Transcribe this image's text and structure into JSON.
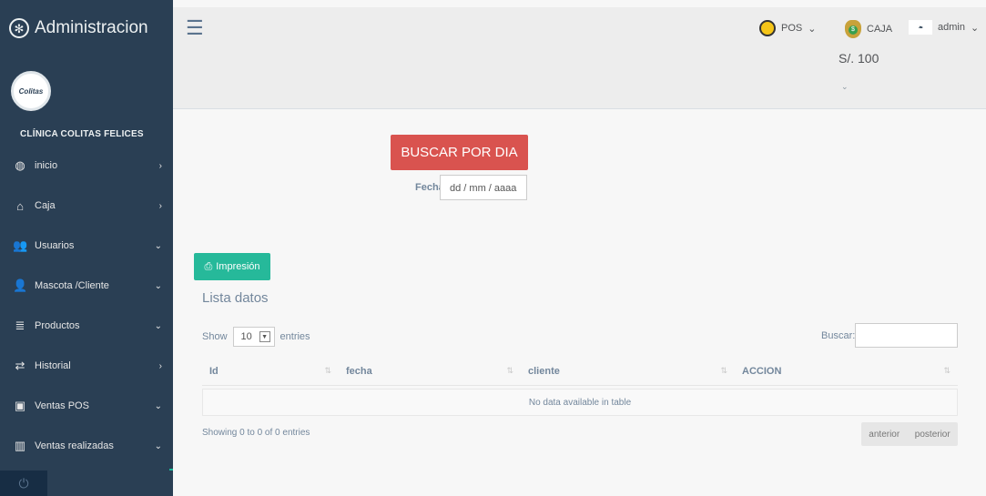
{
  "brand": {
    "title": "Administracion",
    "icon": "gear-icon"
  },
  "avatar": {
    "logo_text": "Colitas"
  },
  "clinic": {
    "name": "CLÍNICA COLITAS FELICES"
  },
  "menu": [
    {
      "label": "inicio",
      "icon": "dashboard-icon",
      "glyph": "◍",
      "chevron": "›"
    },
    {
      "label": "Caja",
      "icon": "bank-icon",
      "glyph": "⌂",
      "chevron": "›"
    },
    {
      "label": "Usuarios",
      "icon": "users-icon",
      "glyph": "👥",
      "chevron": "⌄"
    },
    {
      "label": "Mascota /Cliente",
      "icon": "user-group-icon",
      "glyph": "👤",
      "chevron": "⌄"
    },
    {
      "label": "Productos",
      "icon": "database-icon",
      "glyph": "≣",
      "chevron": "⌄"
    },
    {
      "label": "Historial",
      "icon": "exchange-icon",
      "glyph": "⇄",
      "chevron": "›"
    },
    {
      "label": "Ventas POS",
      "icon": "money-icon",
      "glyph": "▣",
      "chevron": "⌄"
    },
    {
      "label": "Ventas realizadas",
      "icon": "bar-chart-icon",
      "glyph": "▥",
      "chevron": "⌄"
    }
  ],
  "footer": {
    "power_glyph": "⏻"
  },
  "topnav": {
    "pos_label": "POS",
    "pos_caret": "⌄",
    "caja_label": "CAJA",
    "caja_amount": "S/. 100",
    "caja_chevron": "⌄",
    "admin_label": "admin",
    "admin_caret": "⌄"
  },
  "search_day": {
    "button_label": "BUSCAR POR DIA",
    "fecha_label": "Fecha",
    "fecha_placeholder": "dd / mm / aaaa"
  },
  "print": {
    "label": "Impresión",
    "icon": "print-icon"
  },
  "list": {
    "title": "Lista datos",
    "show_label": "Show",
    "length_value": "10",
    "entries_label": "entries",
    "search_label": "Buscar:",
    "columns": [
      "Id",
      "fecha",
      "cliente",
      "ACCION"
    ],
    "empty_text": "No data available in table",
    "info_text": "Showing 0 to 0 of 0 entries",
    "prev_label": "anterior",
    "next_label": "posterior"
  }
}
